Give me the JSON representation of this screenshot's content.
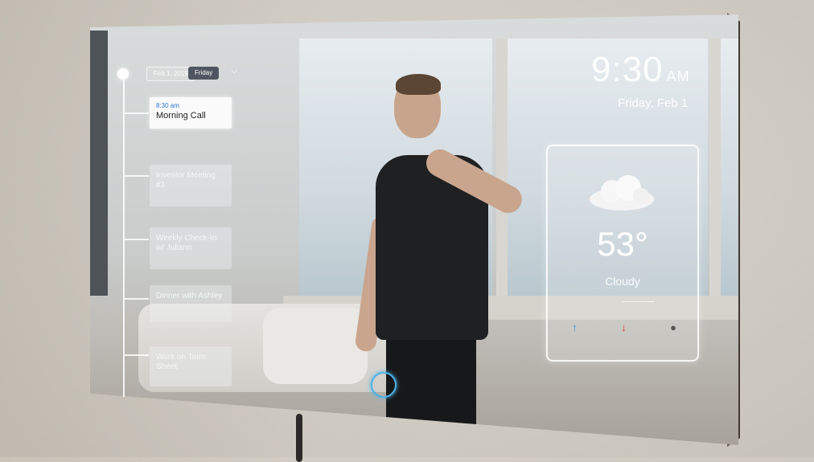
{
  "calendar": {
    "date_chip": "Feb 1, 2019",
    "day_chip": "Friday",
    "events": [
      {
        "time": "8:30 am",
        "title": "Morning Call",
        "active": true
      },
      {
        "time": "",
        "title": "Investor Meeting #3",
        "active": false
      },
      {
        "time": "",
        "title": "Weekly Check-In w/ Juliann",
        "active": false
      },
      {
        "time": "",
        "title": "Dinner with Ashley",
        "active": false
      },
      {
        "time": "",
        "title": "Work on Term Sheet",
        "active": false
      }
    ]
  },
  "clock": {
    "time": "9:30",
    "ampm": "AM",
    "date": "Friday,  Feb 1"
  },
  "weather": {
    "temp": "53°",
    "condition": "Cloudy",
    "icon": "cloud-icon"
  },
  "colors": {
    "accent": "#3a8fe8",
    "touch": "#4fb3e8",
    "down": "#e03b3b"
  }
}
